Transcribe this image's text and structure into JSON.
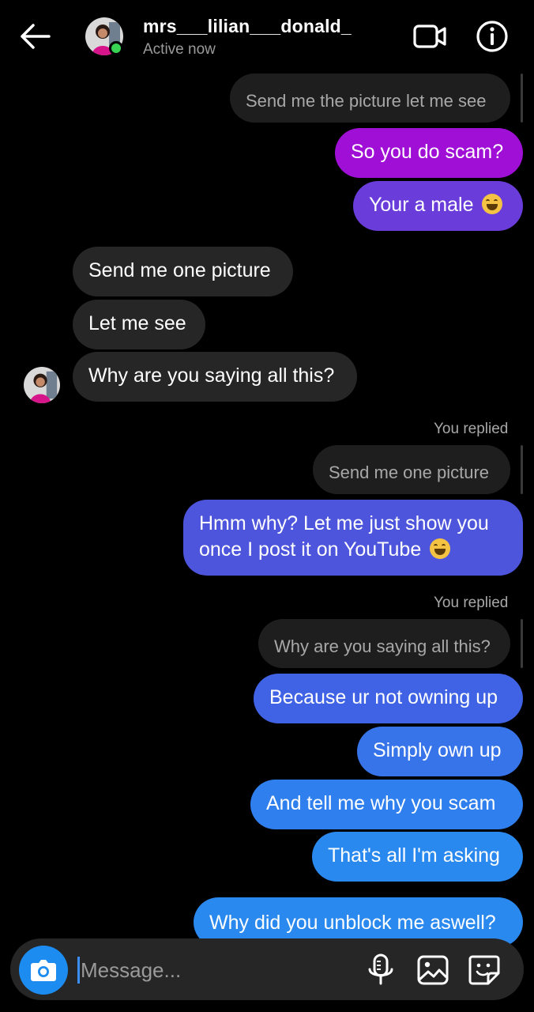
{
  "header": {
    "username": "mrs___lilian___donald_",
    "status": "Active now"
  },
  "messages": {
    "q1": "Send me the picture let me see",
    "m1": "So you do scam?",
    "m2": "Your a male",
    "m3": "Send me one picture",
    "m4": "Let me see",
    "m5": "Why are you saying all this?",
    "replied_1": "You replied",
    "q2": "Send me one picture",
    "m6": "Hmm why? Let me just show you once I post it on YouTube",
    "replied_2": "You replied",
    "q3": "Why are you saying all this?",
    "m7": "Because ur not owning up",
    "m8": "Simply own up",
    "m9": "And tell me why you scam",
    "m10": "That's all I'm asking",
    "m11": "Why did you unblock me aswell?"
  },
  "composer": {
    "placeholder": "Message..."
  },
  "colors": {
    "purple_bubble": "#a00fd6",
    "violet_bubble": "#6a3ddb",
    "blue_bubble": "#2f80ee",
    "incoming_bubble": "#262626",
    "online": "#39d353",
    "camera_button": "#1d8cf0"
  }
}
